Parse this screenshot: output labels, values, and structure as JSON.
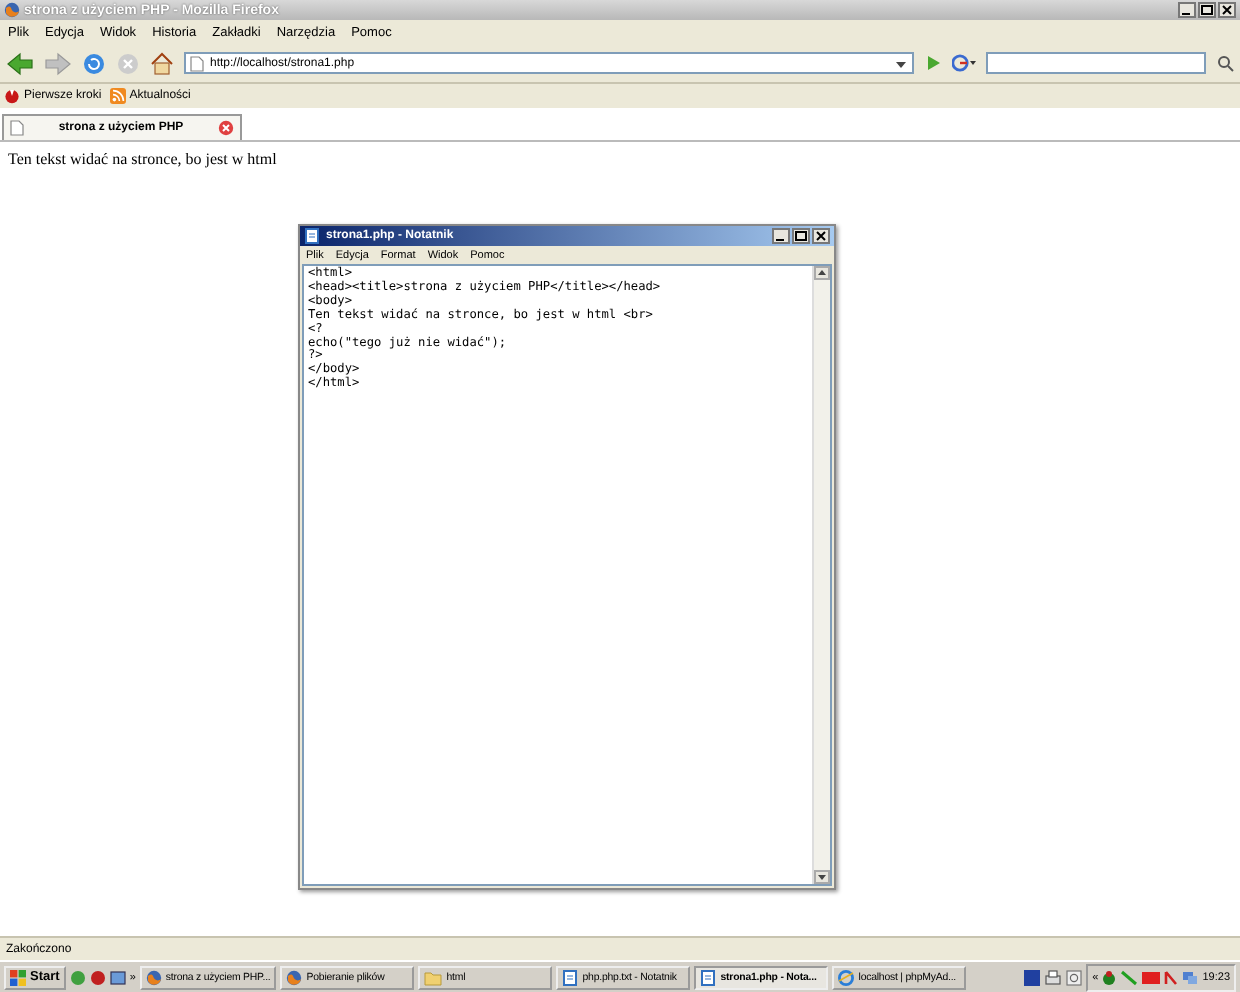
{
  "browser": {
    "title": "strona z użyciem PHP - Mozilla Firefox",
    "menu": [
      "Plik",
      "Edycja",
      "Widok",
      "Historia",
      "Zakładki",
      "Narzędzia",
      "Pomoc"
    ],
    "address": "http://localhost/strona1.php",
    "bookmarks": [
      {
        "label": "Pierwsze kroki",
        "kind": "start"
      },
      {
        "label": "Aktualności",
        "kind": "feed"
      }
    ],
    "tabs": [
      {
        "label": "strona z użyciem PHP",
        "selected": true
      }
    ],
    "page_text": "Ten tekst widać na stronce, bo jest w html",
    "status": "Zakończono"
  },
  "notepad": {
    "title": "strona1.php - Notatnik",
    "menu": [
      "Plik",
      "Edycja",
      "Format",
      "Widok",
      "Pomoc"
    ],
    "lines": [
      "<html>",
      "<head><title>strona z użyciem PHP</title></head>",
      "<body>",
      "Ten tekst widać na stronce, bo jest w html <br>",
      "<?",
      "echo(\"tego już nie widać\");",
      "?>",
      "</body>",
      "</html>"
    ]
  },
  "taskbar": {
    "start": "Start",
    "more": "»",
    "buttons": [
      {
        "label": "strona z użyciem PHP...",
        "kind": "firefox",
        "selected": false
      },
      {
        "label": "Pobieranie plików",
        "kind": "firefox",
        "selected": false
      },
      {
        "label": "html",
        "kind": "folder",
        "selected": false
      },
      {
        "label": "php.php.txt - Notatnik",
        "kind": "notepad",
        "selected": false
      },
      {
        "label": "strona1.php - Nota...",
        "kind": "notepad",
        "selected": true
      },
      {
        "label": "localhost | phpMyAd...",
        "kind": "ie",
        "selected": false
      }
    ],
    "tray_more": "«",
    "clock": "19:23"
  }
}
